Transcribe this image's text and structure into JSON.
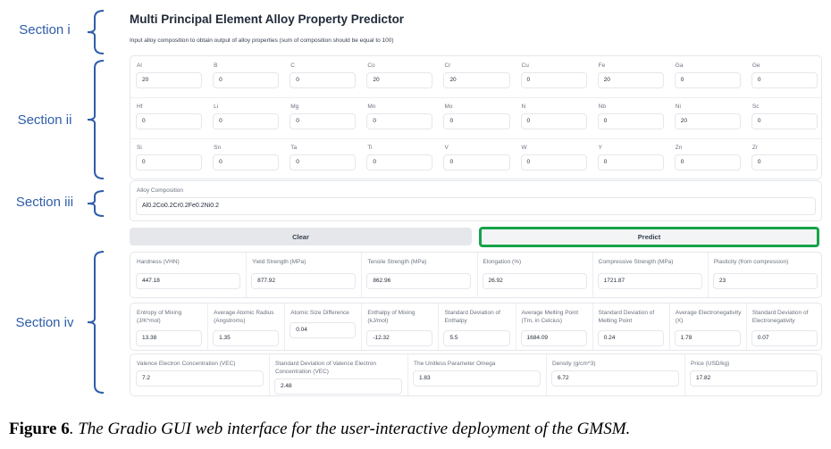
{
  "sections": [
    "Section i",
    "Section ii",
    "Section iii",
    "Section iv"
  ],
  "header": {
    "title": "Multi Principal Element Alloy Property Predictor",
    "subtitle": "Input alloy composition to obtain output of alloy properties (sum of composition should be equal to 100)"
  },
  "elements": [
    {
      "label": "Al",
      "value": "20"
    },
    {
      "label": "B",
      "value": "0"
    },
    {
      "label": "C",
      "value": "0"
    },
    {
      "label": "Co",
      "value": "20"
    },
    {
      "label": "Cr",
      "value": "20"
    },
    {
      "label": "Cu",
      "value": "0"
    },
    {
      "label": "Fe",
      "value": "20"
    },
    {
      "label": "Ga",
      "value": "0"
    },
    {
      "label": "Ge",
      "value": "0"
    },
    {
      "label": "Hf",
      "value": "0"
    },
    {
      "label": "Li",
      "value": "0"
    },
    {
      "label": "Mg",
      "value": "0"
    },
    {
      "label": "Mn",
      "value": "0"
    },
    {
      "label": "Mo",
      "value": "0"
    },
    {
      "label": "N",
      "value": "0"
    },
    {
      "label": "Nb",
      "value": "0"
    },
    {
      "label": "Ni",
      "value": "20"
    },
    {
      "label": "Sc",
      "value": "0"
    },
    {
      "label": "Si",
      "value": "0"
    },
    {
      "label": "Sn",
      "value": "0"
    },
    {
      "label": "Ta",
      "value": "0"
    },
    {
      "label": "Ti",
      "value": "0"
    },
    {
      "label": "V",
      "value": "0"
    },
    {
      "label": "W",
      "value": "0"
    },
    {
      "label": "Y",
      "value": "0"
    },
    {
      "label": "Zn",
      "value": "0"
    },
    {
      "label": "Zr",
      "value": "0"
    }
  ],
  "composition": {
    "label": "Alloy Composition",
    "value": "Al0.2Co0.2Cr0.2Fe0.2Ni0.2"
  },
  "buttons": {
    "clear": "Clear",
    "predict": "Predict"
  },
  "outputs_row1": [
    {
      "label": "Hardness (VHN)",
      "value": "447.18"
    },
    {
      "label": "Yield Strength (MPa)",
      "value": "877.92"
    },
    {
      "label": "Tensile Strength (MPa)",
      "value": "862.96"
    },
    {
      "label": "Elongation (%)",
      "value": "26.92"
    },
    {
      "label": "Compressive Strength (MPa)",
      "value": "1721.87"
    },
    {
      "label": "Plasticity (from compression)",
      "value": "23"
    }
  ],
  "outputs_row2": [
    {
      "label": "Entropy of Mixing (J/K*mol)",
      "value": "13.38"
    },
    {
      "label": "Average Atomic Radius (Angstroms)",
      "value": "1.35"
    },
    {
      "label": "Atomic Size Difference",
      "value": "0.04"
    },
    {
      "label": "Enthalpy of Mixing (kJ/mol)",
      "value": "-12.32"
    },
    {
      "label": "Standard Deviation of Enthalpy",
      "value": "5.5"
    },
    {
      "label": "Average Melting Point (Tm, in Celcius)",
      "value": "1684.09"
    },
    {
      "label": "Standard Deviation of Melting Point",
      "value": "0.24"
    },
    {
      "label": "Average Electronegativity (X)",
      "value": "1.78"
    },
    {
      "label": "Standard Deviation of Electronegativity",
      "value": "0.07"
    }
  ],
  "outputs_row3": [
    {
      "label": "Valence Electron Concentration (VEC)",
      "value": "7.2"
    },
    {
      "label": "Standard Deviation of Valence Electron Concentration (VEC)",
      "value": "2.48"
    },
    {
      "label": "The Unitless Parameter Omega",
      "value": "1.83"
    },
    {
      "label": "Density (g/cm^3)",
      "value": "6.72"
    },
    {
      "label": "Price (USD/kg)",
      "value": "17.82"
    }
  ],
  "caption": {
    "figure": "Figure 6",
    "text": ". The Gradio GUI web interface for the user-interactive deployment of the GMSM."
  },
  "colors": {
    "section_label": "#2e5da8",
    "predict_highlight": "#16a34a"
  }
}
